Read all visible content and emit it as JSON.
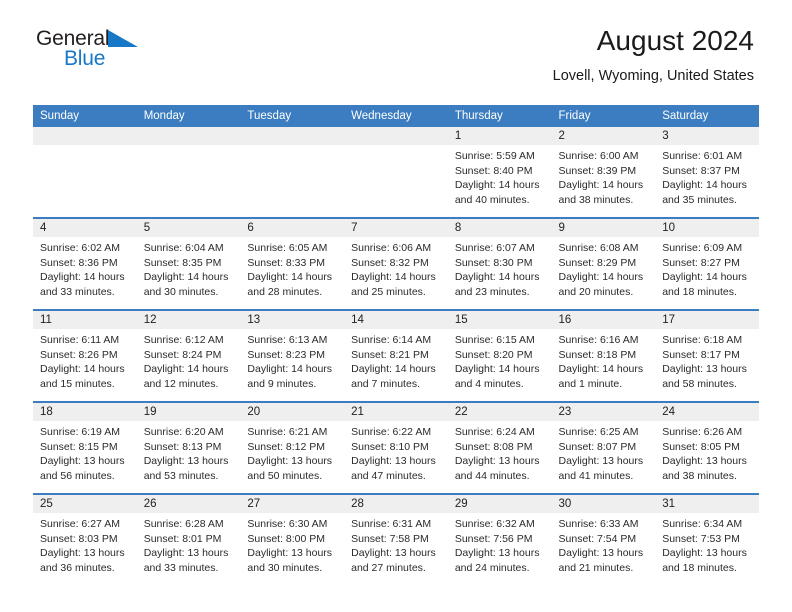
{
  "brand": {
    "name_part1": "General",
    "name_part2": "Blue",
    "triangle_color": "#1878c8",
    "text_color": "#231f20"
  },
  "header": {
    "title": "August 2024",
    "subtitle": "Lovell, Wyoming, United States"
  },
  "theme": {
    "header_blue": "#3b7dc0",
    "daynum_band": "#efefef",
    "cell_background": "#ffffff"
  },
  "weekdays": [
    "Sunday",
    "Monday",
    "Tuesday",
    "Wednesday",
    "Thursday",
    "Friday",
    "Saturday"
  ],
  "weeks": [
    [
      {
        "empty": true
      },
      {
        "empty": true
      },
      {
        "empty": true
      },
      {
        "empty": true
      },
      {
        "day": "1",
        "sunrise": "Sunrise: 5:59 AM",
        "sunset": "Sunset: 8:40 PM",
        "daylight_line1": "Daylight: 14 hours",
        "daylight_line2": "and 40 minutes."
      },
      {
        "day": "2",
        "sunrise": "Sunrise: 6:00 AM",
        "sunset": "Sunset: 8:39 PM",
        "daylight_line1": "Daylight: 14 hours",
        "daylight_line2": "and 38 minutes."
      },
      {
        "day": "3",
        "sunrise": "Sunrise: 6:01 AM",
        "sunset": "Sunset: 8:37 PM",
        "daylight_line1": "Daylight: 14 hours",
        "daylight_line2": "and 35 minutes."
      }
    ],
    [
      {
        "day": "4",
        "sunrise": "Sunrise: 6:02 AM",
        "sunset": "Sunset: 8:36 PM",
        "daylight_line1": "Daylight: 14 hours",
        "daylight_line2": "and 33 minutes."
      },
      {
        "day": "5",
        "sunrise": "Sunrise: 6:04 AM",
        "sunset": "Sunset: 8:35 PM",
        "daylight_line1": "Daylight: 14 hours",
        "daylight_line2": "and 30 minutes."
      },
      {
        "day": "6",
        "sunrise": "Sunrise: 6:05 AM",
        "sunset": "Sunset: 8:33 PM",
        "daylight_line1": "Daylight: 14 hours",
        "daylight_line2": "and 28 minutes."
      },
      {
        "day": "7",
        "sunrise": "Sunrise: 6:06 AM",
        "sunset": "Sunset: 8:32 PM",
        "daylight_line1": "Daylight: 14 hours",
        "daylight_line2": "and 25 minutes."
      },
      {
        "day": "8",
        "sunrise": "Sunrise: 6:07 AM",
        "sunset": "Sunset: 8:30 PM",
        "daylight_line1": "Daylight: 14 hours",
        "daylight_line2": "and 23 minutes."
      },
      {
        "day": "9",
        "sunrise": "Sunrise: 6:08 AM",
        "sunset": "Sunset: 8:29 PM",
        "daylight_line1": "Daylight: 14 hours",
        "daylight_line2": "and 20 minutes."
      },
      {
        "day": "10",
        "sunrise": "Sunrise: 6:09 AM",
        "sunset": "Sunset: 8:27 PM",
        "daylight_line1": "Daylight: 14 hours",
        "daylight_line2": "and 18 minutes."
      }
    ],
    [
      {
        "day": "11",
        "sunrise": "Sunrise: 6:11 AM",
        "sunset": "Sunset: 8:26 PM",
        "daylight_line1": "Daylight: 14 hours",
        "daylight_line2": "and 15 minutes."
      },
      {
        "day": "12",
        "sunrise": "Sunrise: 6:12 AM",
        "sunset": "Sunset: 8:24 PM",
        "daylight_line1": "Daylight: 14 hours",
        "daylight_line2": "and 12 minutes."
      },
      {
        "day": "13",
        "sunrise": "Sunrise: 6:13 AM",
        "sunset": "Sunset: 8:23 PM",
        "daylight_line1": "Daylight: 14 hours",
        "daylight_line2": "and 9 minutes."
      },
      {
        "day": "14",
        "sunrise": "Sunrise: 6:14 AM",
        "sunset": "Sunset: 8:21 PM",
        "daylight_line1": "Daylight: 14 hours",
        "daylight_line2": "and 7 minutes."
      },
      {
        "day": "15",
        "sunrise": "Sunrise: 6:15 AM",
        "sunset": "Sunset: 8:20 PM",
        "daylight_line1": "Daylight: 14 hours",
        "daylight_line2": "and 4 minutes."
      },
      {
        "day": "16",
        "sunrise": "Sunrise: 6:16 AM",
        "sunset": "Sunset: 8:18 PM",
        "daylight_line1": "Daylight: 14 hours",
        "daylight_line2": "and 1 minute."
      },
      {
        "day": "17",
        "sunrise": "Sunrise: 6:18 AM",
        "sunset": "Sunset: 8:17 PM",
        "daylight_line1": "Daylight: 13 hours",
        "daylight_line2": "and 58 minutes."
      }
    ],
    [
      {
        "day": "18",
        "sunrise": "Sunrise: 6:19 AM",
        "sunset": "Sunset: 8:15 PM",
        "daylight_line1": "Daylight: 13 hours",
        "daylight_line2": "and 56 minutes."
      },
      {
        "day": "19",
        "sunrise": "Sunrise: 6:20 AM",
        "sunset": "Sunset: 8:13 PM",
        "daylight_line1": "Daylight: 13 hours",
        "daylight_line2": "and 53 minutes."
      },
      {
        "day": "20",
        "sunrise": "Sunrise: 6:21 AM",
        "sunset": "Sunset: 8:12 PM",
        "daylight_line1": "Daylight: 13 hours",
        "daylight_line2": "and 50 minutes."
      },
      {
        "day": "21",
        "sunrise": "Sunrise: 6:22 AM",
        "sunset": "Sunset: 8:10 PM",
        "daylight_line1": "Daylight: 13 hours",
        "daylight_line2": "and 47 minutes."
      },
      {
        "day": "22",
        "sunrise": "Sunrise: 6:24 AM",
        "sunset": "Sunset: 8:08 PM",
        "daylight_line1": "Daylight: 13 hours",
        "daylight_line2": "and 44 minutes."
      },
      {
        "day": "23",
        "sunrise": "Sunrise: 6:25 AM",
        "sunset": "Sunset: 8:07 PM",
        "daylight_line1": "Daylight: 13 hours",
        "daylight_line2": "and 41 minutes."
      },
      {
        "day": "24",
        "sunrise": "Sunrise: 6:26 AM",
        "sunset": "Sunset: 8:05 PM",
        "daylight_line1": "Daylight: 13 hours",
        "daylight_line2": "and 38 minutes."
      }
    ],
    [
      {
        "day": "25",
        "sunrise": "Sunrise: 6:27 AM",
        "sunset": "Sunset: 8:03 PM",
        "daylight_line1": "Daylight: 13 hours",
        "daylight_line2": "and 36 minutes."
      },
      {
        "day": "26",
        "sunrise": "Sunrise: 6:28 AM",
        "sunset": "Sunset: 8:01 PM",
        "daylight_line1": "Daylight: 13 hours",
        "daylight_line2": "and 33 minutes."
      },
      {
        "day": "27",
        "sunrise": "Sunrise: 6:30 AM",
        "sunset": "Sunset: 8:00 PM",
        "daylight_line1": "Daylight: 13 hours",
        "daylight_line2": "and 30 minutes."
      },
      {
        "day": "28",
        "sunrise": "Sunrise: 6:31 AM",
        "sunset": "Sunset: 7:58 PM",
        "daylight_line1": "Daylight: 13 hours",
        "daylight_line2": "and 27 minutes."
      },
      {
        "day": "29",
        "sunrise": "Sunrise: 6:32 AM",
        "sunset": "Sunset: 7:56 PM",
        "daylight_line1": "Daylight: 13 hours",
        "daylight_line2": "and 24 minutes."
      },
      {
        "day": "30",
        "sunrise": "Sunrise: 6:33 AM",
        "sunset": "Sunset: 7:54 PM",
        "daylight_line1": "Daylight: 13 hours",
        "daylight_line2": "and 21 minutes."
      },
      {
        "day": "31",
        "sunrise": "Sunrise: 6:34 AM",
        "sunset": "Sunset: 7:53 PM",
        "daylight_line1": "Daylight: 13 hours",
        "daylight_line2": "and 18 minutes."
      }
    ]
  ]
}
